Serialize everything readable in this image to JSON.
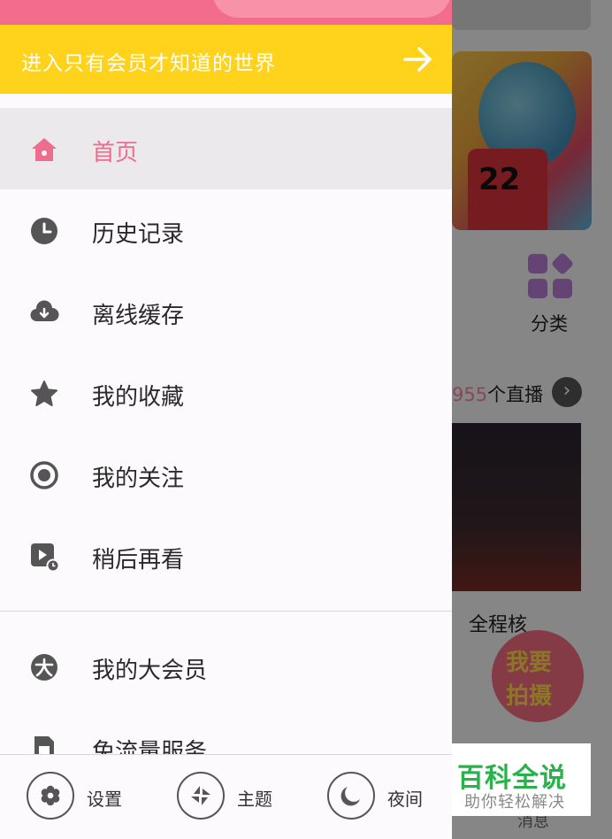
{
  "vip_banner": {
    "text": "进入只有会员才知道的世界"
  },
  "menu": [
    {
      "label": "首页",
      "icon": "home-icon",
      "active": true
    },
    {
      "label": "历史记录",
      "icon": "clock-icon"
    },
    {
      "label": "离线缓存",
      "icon": "cloud-download-icon"
    },
    {
      "label": "我的收藏",
      "icon": "star-icon"
    },
    {
      "label": "我的关注",
      "icon": "target-icon"
    },
    {
      "label": "稍后再看",
      "icon": "play-later-icon"
    }
  ],
  "menu_secondary": [
    {
      "label": "我的大会员",
      "icon": "vip-icon"
    },
    {
      "label": "免流量服务",
      "icon": "sim-card-icon"
    }
  ],
  "bottom_bar": {
    "settings": "设置",
    "theme": "主题",
    "night": "夜间"
  },
  "background_app": {
    "category_label": "分类",
    "live_count": "955",
    "live_suffix": "个直播",
    "card_caption": "全程核",
    "shoot_line1": "我要",
    "shoot_line2": "拍摄",
    "bottom_tab": "消息",
    "banner_text": "22"
  },
  "watermark": {
    "title": "百科全说",
    "subtitle": "助你轻松解决"
  },
  "colors": {
    "accent_pink": "#f06c8f",
    "vip_yellow": "#ffd21c",
    "icon_gray": "#555555"
  }
}
